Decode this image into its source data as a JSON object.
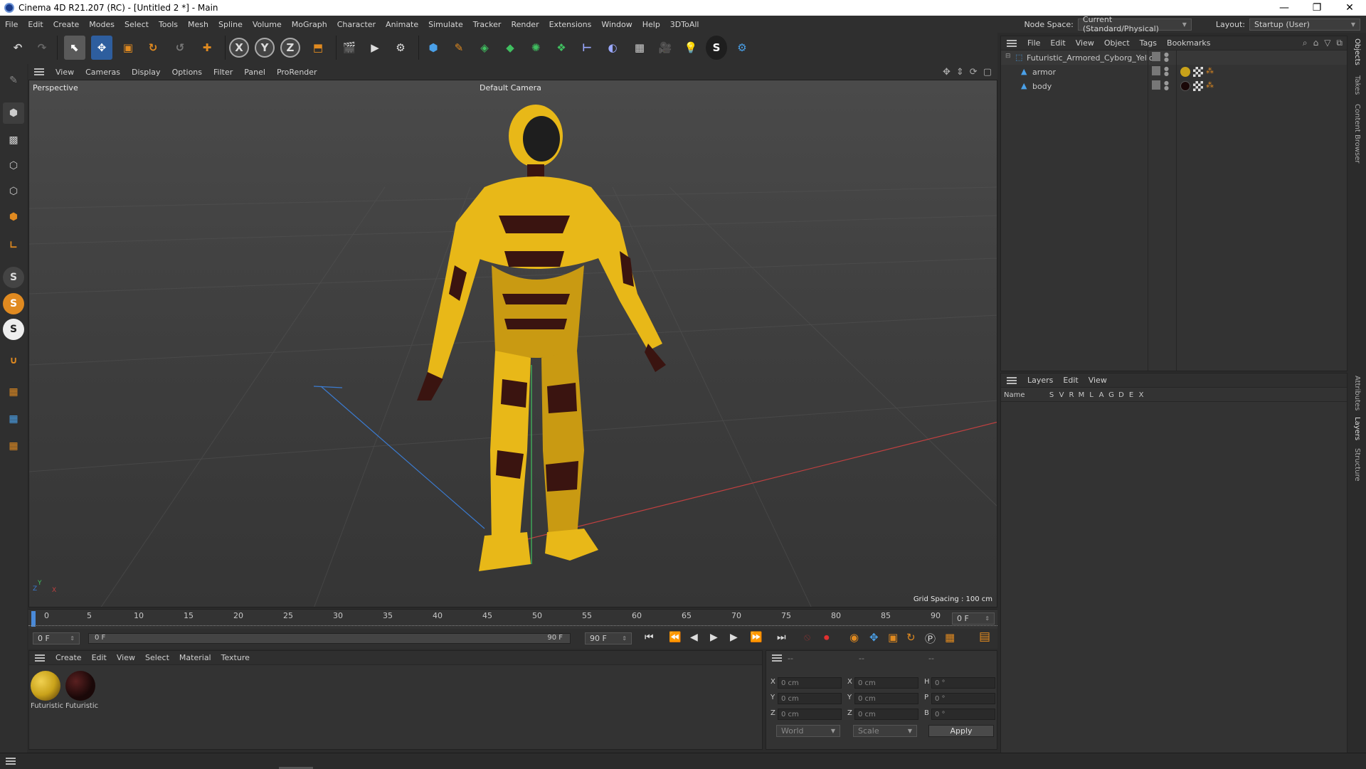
{
  "window": {
    "title": "Cinema 4D R21.207 (RC) - [Untitled 2 *] - Main",
    "minimize": "—",
    "restore": "❐",
    "close": "✕"
  },
  "menu": [
    "File",
    "Edit",
    "Create",
    "Modes",
    "Select",
    "Tools",
    "Mesh",
    "Spline",
    "Volume",
    "MoGraph",
    "Character",
    "Animate",
    "Simulate",
    "Tracker",
    "Render",
    "Extensions",
    "Window",
    "Help",
    "3DToAll"
  ],
  "node_space": {
    "label": "Node Space:",
    "value": "Current (Standard/Physical)"
  },
  "layout": {
    "label": "Layout:",
    "value": "Startup (User)"
  },
  "toolbar": {
    "axis_x": "X",
    "axis_y": "Y",
    "axis_z": "Z"
  },
  "viewport": {
    "menu": [
      "View",
      "Cameras",
      "Display",
      "Options",
      "Filter",
      "Panel",
      "ProRender"
    ],
    "view_name": "Perspective",
    "camera": "Default Camera",
    "grid_spacing": "Grid Spacing : 100 cm",
    "axis_x": "X",
    "axis_y": "Y",
    "axis_z": "Z"
  },
  "timeline": {
    "ticks": [
      "0",
      "5",
      "10",
      "15",
      "20",
      "25",
      "30",
      "35",
      "40",
      "45",
      "50",
      "55",
      "60",
      "65",
      "70",
      "75",
      "80",
      "85",
      "90"
    ],
    "current_frame": "0 F",
    "start_frame": "0 F",
    "range_start": "0 F",
    "range_end": "90 F",
    "end_frame": "90 F"
  },
  "material_panel": {
    "menu": [
      "Create",
      "Edit",
      "View",
      "Select",
      "Material",
      "Texture"
    ],
    "materials": [
      {
        "label": "Futuristic",
        "color": "#c9a21a"
      },
      {
        "label": "Futuristic",
        "color": "#1a0808"
      }
    ]
  },
  "coord_panel": {
    "col1": "--",
    "col2": "--",
    "col3": "--",
    "rows": [
      {
        "a": "X",
        "av": "0 cm",
        "b": "X",
        "bv": "0 cm",
        "c": "H",
        "cv": "0 °"
      },
      {
        "a": "Y",
        "av": "0 cm",
        "b": "Y",
        "bv": "0 cm",
        "c": "P",
        "cv": "0 °"
      },
      {
        "a": "Z",
        "av": "0 cm",
        "b": "Z",
        "bv": "0 cm",
        "c": "B",
        "cv": "0 °"
      }
    ],
    "world": "World",
    "scale": "Scale",
    "apply": "Apply"
  },
  "object_panel": {
    "menu": [
      "File",
      "Edit",
      "View",
      "Object",
      "Tags",
      "Bookmarks"
    ],
    "root": "Futuristic_Armored_Cyborg_Yellow",
    "children": [
      "armor",
      "body"
    ]
  },
  "layers_panel": {
    "menu": [
      "Layers",
      "Edit",
      "View"
    ],
    "name_col": "Name",
    "flags": [
      "S",
      "V",
      "R",
      "M",
      "L",
      "A",
      "G",
      "D",
      "E",
      "X"
    ]
  },
  "side_tabs": [
    "Objects",
    "Takes",
    "Content Browser",
    "Attributes",
    "Layers",
    "Structure"
  ],
  "colors": {
    "armor_yellow": "#e8b818",
    "armor_dark": "#3a1410",
    "accent_blue": "#3b7bd0",
    "x_axis": "#c04040",
    "y_axis": "#40c060"
  }
}
